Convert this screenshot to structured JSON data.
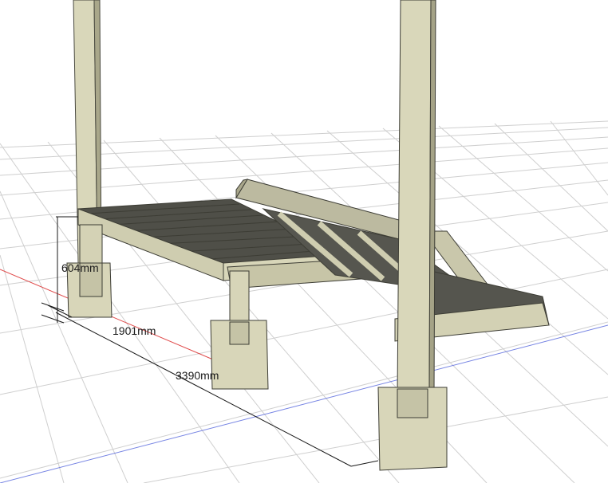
{
  "dimensions": {
    "height_label": "604mm",
    "deck_length_label": "1901mm",
    "total_length_label": "3390mm"
  },
  "colors": {
    "wood_light": "#d8d6b8",
    "wood_mid": "#c4c2a0",
    "wood_dark": "#8e8c72",
    "slat": "#5f5f58",
    "grid": "#c9c9c9",
    "axis_x": "#e04a4a",
    "axis_y": "#4a5ae0",
    "edge": "#3d3d35"
  }
}
